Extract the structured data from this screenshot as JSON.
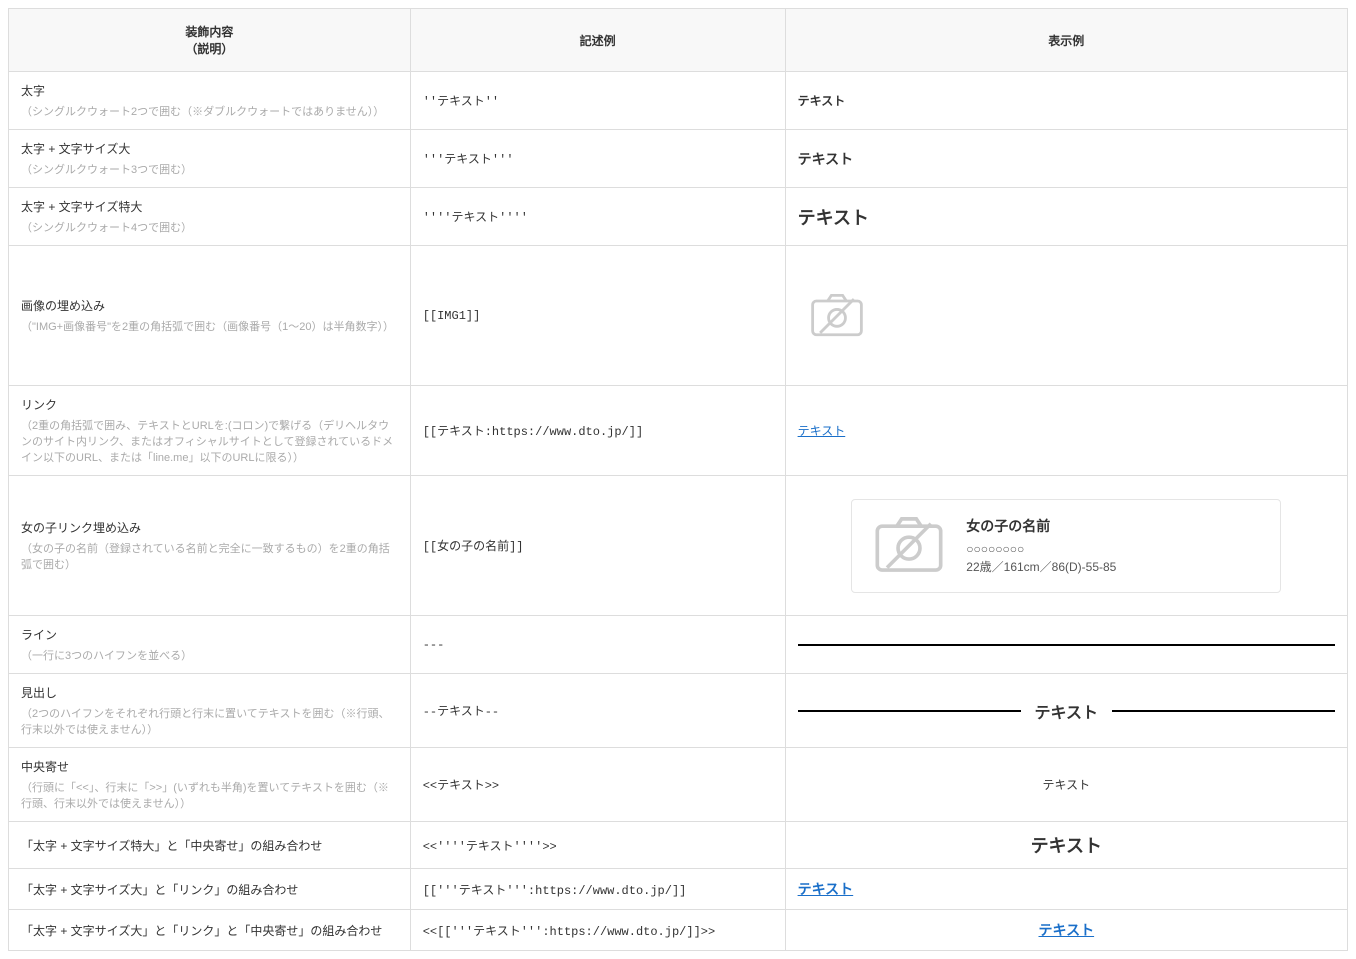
{
  "headers": {
    "col1_line1": "装飾内容",
    "col1_line2": "（説明）",
    "col2": "記述例",
    "col3": "表示例"
  },
  "rows": {
    "bold": {
      "title": "太字",
      "note": "（シングルクウォート2つで囲む（※ダブルクウォートではありません））",
      "syntax": "''テキスト''",
      "example": "テキスト"
    },
    "boldLarge": {
      "title": "太字 + 文字サイズ大",
      "note": "（シングルクウォート3つで囲む）",
      "syntax": "'''テキスト'''",
      "example": "テキスト"
    },
    "boldXLarge": {
      "title": "太字 + 文字サイズ特大",
      "note": "（シングルクウォート4つで囲む）",
      "syntax": "''''テキスト''''",
      "example": "テキスト"
    },
    "image": {
      "title": "画像の埋め込み",
      "note": "（\"IMG+画像番号\"を2重の角括弧で囲む（画像番号（1〜20）は半角数字））",
      "syntax": "[[IMG1]]"
    },
    "link": {
      "title": "リンク",
      "note": "（2重の角括弧で囲み、テキストとURLを:(コロン)で繋げる（デリヘルタウンのサイト内リンク、またはオフィシャルサイトとして登録されているドメイン以下のURL、または「line.me」以下のURLに限る））",
      "syntax": "[[テキスト:https://www.dto.jp/]]",
      "example": "テキスト"
    },
    "girl": {
      "title": "女の子リンク埋め込み",
      "note": "（女の子の名前（登録されている名前と完全に一致するもの）を2重の角括弧で囲む）",
      "syntax": "[[女の子の名前]]",
      "card": {
        "name": "女の子の名前",
        "dots": "○○○○○○○○",
        "stats": "22歳／161cm／86(D)-55-85"
      }
    },
    "line": {
      "title": "ライン",
      "note": "（一行に3つのハイフンを並べる）",
      "syntax": "---"
    },
    "heading": {
      "title": "見出し",
      "note": "（2つのハイフンをそれぞれ行頭と行末に置いてテキストを囲む（※行頭、行末以外では使えません））",
      "syntax": "--テキスト--",
      "example": "テキスト"
    },
    "center": {
      "title": "中央寄せ",
      "note": "（行頭に「<<」、行末に「>>」(いずれも半角)を置いてテキストを囲む（※行頭、行末以外では使えません））",
      "syntax": "<<テキスト>>",
      "example": "テキスト"
    },
    "combo1": {
      "title": "「太字 + 文字サイズ特大」と「中央寄せ」の組み合わせ",
      "syntax": "<<''''テキスト''''>>",
      "example": "テキスト"
    },
    "combo2": {
      "title": "「太字 + 文字サイズ大」と「リンク」の組み合わせ",
      "syntax": "[['''テキスト''':https://www.dto.jp/]]",
      "example": "テキスト"
    },
    "combo3": {
      "title": "「太字 + 文字サイズ大」と「リンク」と「中央寄せ」の組み合わせ",
      "syntax": "<<[['''テキスト''':https://www.dto.jp/]]>>",
      "example": "テキスト"
    }
  }
}
